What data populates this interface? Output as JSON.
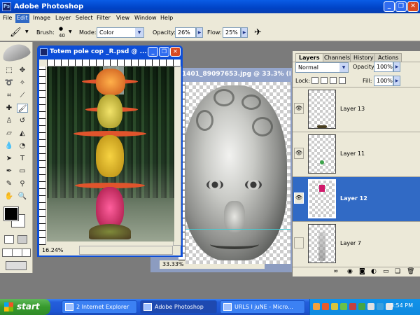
{
  "app": {
    "title": "Adobe Photoshop"
  },
  "menu": [
    "File",
    "Edit",
    "Image",
    "Layer",
    "Select",
    "Filter",
    "View",
    "Window",
    "Help"
  ],
  "options": {
    "brush_label": "Brush:",
    "brush_size": "40",
    "mode_label": "Mode:",
    "mode_value": "Color",
    "opacity_label": "Opacity:",
    "opacity_value": "26%",
    "flow_label": "Flow:",
    "flow_value": "25%"
  },
  "doc1": {
    "title": "Totem pole cop _R.psd @ ...",
    "zoom": "16.24%"
  },
  "doc2": {
    "title": "1401_89097653.jpg @ 33.3% (Ba...",
    "zoom": "33.33%"
  },
  "layers_panel": {
    "tabs": [
      "Layers",
      "Channels",
      "History",
      "Actions"
    ],
    "blend": "Normal",
    "opacity_label": "Opacity:",
    "opacity": "100%",
    "lock_label": "Lock:",
    "fill_label": "Fill:",
    "fill": "100%",
    "items": [
      {
        "name": "Layer 13",
        "visible": "👁"
      },
      {
        "name": "Layer 11",
        "visible": "👁"
      },
      {
        "name": "Layer 12",
        "visible": "👁"
      },
      {
        "name": "Layer 7",
        "visible": ""
      }
    ]
  },
  "taskbar": {
    "start": "start",
    "tasks": [
      "2 Internet Explorer",
      "Adobe Photoshop",
      "URLS I juNE - Micro..."
    ],
    "clock": "3:54 PM"
  }
}
